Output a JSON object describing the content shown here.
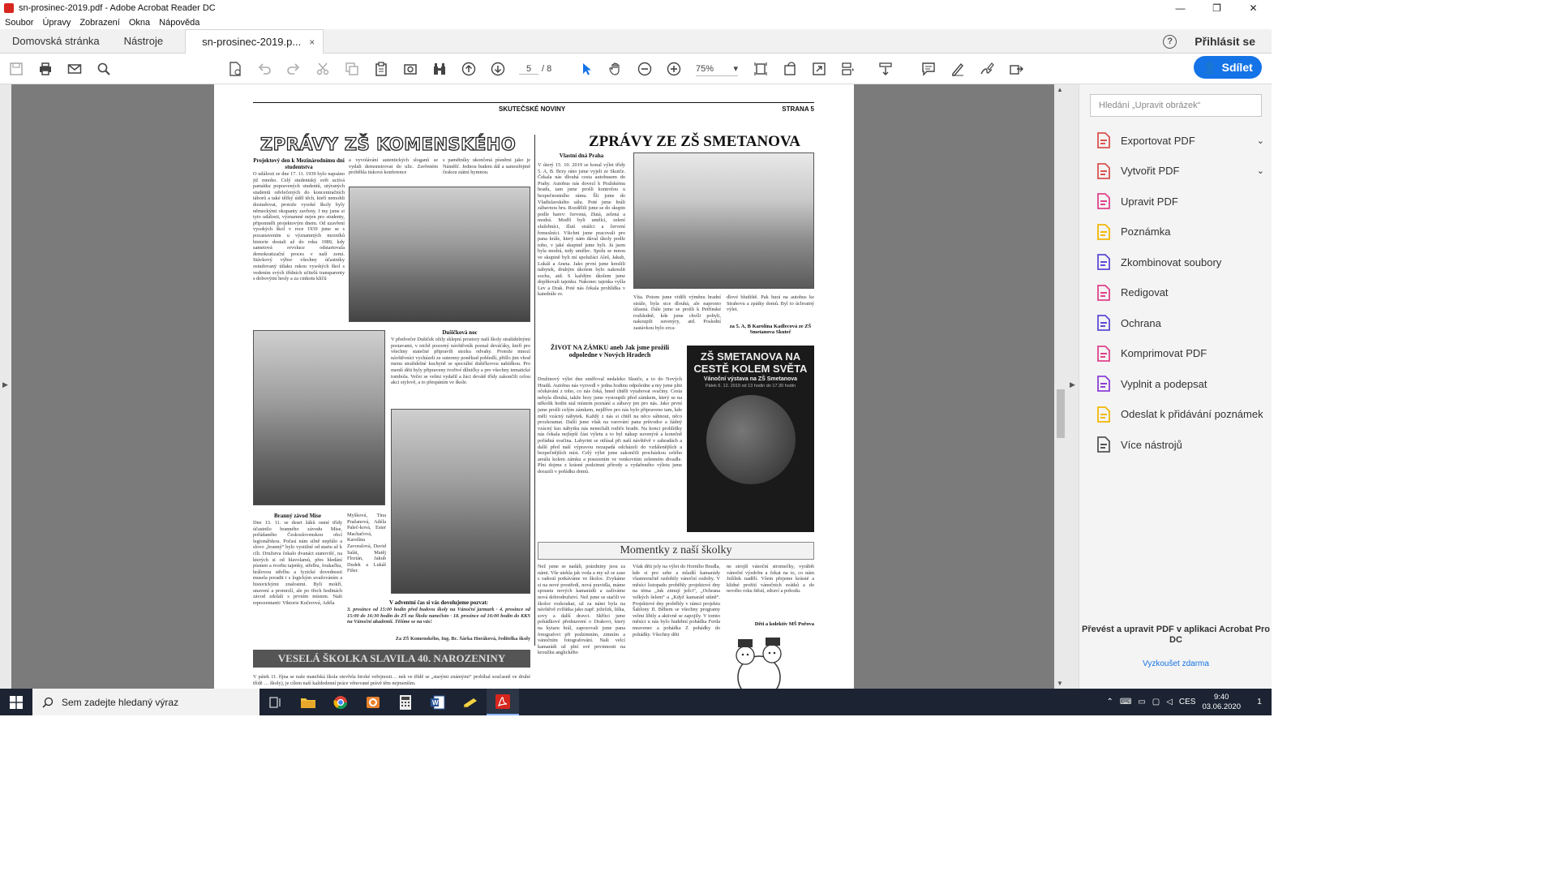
{
  "window": {
    "title": "sn-prosinec-2019.pdf - Adobe Acrobat Reader DC",
    "minimize": "—",
    "maximize": "❐",
    "close": "✕"
  },
  "menu": [
    "Soubor",
    "Úpravy",
    "Zobrazení",
    "Okna",
    "Nápověda"
  ],
  "tabs": {
    "home": "Domovská stránka",
    "tools": "Nástroje",
    "document": "sn-prosinec-2019.p...",
    "close": "×",
    "help": "?",
    "signin": "Přihlásit se"
  },
  "toolbar": {
    "page_current": "5",
    "page_total": "/ 8",
    "zoom": "75%",
    "share": "Sdílet"
  },
  "page": {
    "running_head_center": "SKUTEČSKÉ NOVINY",
    "running_head_right": "STRANA 5",
    "left_heading": "ZPRÁVY ZŠ KOMENSKÉHO",
    "right_heading": "ZPRÁVY ZE ZŠ SMETANOVA",
    "sub_projektovy": "Projektový den k Mezinárodnímu dni studentstva",
    "txt_projektovy": "O události ze dne 17. 11. 1939 bylo napsáno již mnoho. Celý studentský svět uctívá památku popravených studentů, utýraných studentů odvlečených do koncentračních táborů a také těžký úděl těch, kteří nemohli dostudovat, protože vysoké školy byly německými okupanty zavřeny. I my jsme si tyto události, významné nejen pro studenty, připomněli projektovým dnem. Od uzavření vysokých škol v roce 1939 jsme se s pozastavením u významných mezníků historie dostali až do roku 1989, kdy sametová revoluce odstartovala demokratizační proces v naší zemi. Stávkový výbor všechny účastníky ostudovaný útlaku rukou vysokých škol s vedením svých třídních učitelů transparenty s dobovými hesly a za cinkotu klíčů",
    "txt_col2_top": "a vyvolávání autentických sloganů se vydali demonstrovat do ulic. Zavřeném proběhla tisková konference",
    "txt_col3_top": "s pamětníky ukončená písněmi jako je Náměšť. Jednou budem dál a samozřejmě českou státní hymnou.",
    "sub_duchova": "Dušičková noc",
    "txt_duchova": "V předvečer Dušiček ožily sklepní prostory naší školy strašidelnými postavami, v nichž pozorný návštěvník poznal deváťáky, kteří pro všechny statečné připravili stezku odvahy. Protože mnozí návštěvníci vycházeli ze sutereny poněkud pobledlí, přišlo jim vhod menu strašidelné kuchyně se speciální dušičkovou nabídkou. Pro menší děti byly připraveny tvořivé dílničky a pro všechny tematické tombola. Večer se velmi vydařil a žáci devátě třídy zakončili celou akci stylově, a to přespáním ve škole.",
    "sub_zavod": "Branný závod Míse",
    "txt_zavod": "Dne 13. 11. se deset žáků osmé třídy účastnilo branného závodu Míse, pořádaného Československou obcí legionářskou. Počasí nám silně nepřálo a slovo „branný“ bylo vystižné od startu až k cíli. Družstva čekalo dvanáct stanovišť, na kterých si od hlavolamů, přes hledání písmen a tvorbu tajenky, střelbu, foukačku, hrálovou střelbu a fyzické dovednosti musela poradit i s logickým uvažováním a historickými znalostmi. Byli mokří, unavení a promrzlí, ale po třech hodinách závod zdolali s prvním místem. Naši reprezentanti: Viktorie Kučerová, Adéla",
    "txt_zavod2": "Myšková, Tina Pražanová, Adéla Paleč-ková, Ester Machačová, Karolína Zavoralová, David Salát, Matěj Florián, Jakub Dudek a Lukáš Fišer.",
    "sub_advent": "V adventní čas si vás dovolujeme pozvat:",
    "txt_advent": "3. prosince od 15:00 hodin před budovu školy na Vánoční jarmark · 4. prosince od 15:00 do 16:30 hodin do ZŠ na Školu nanečisto · 18. prosince od 16:00 hodin do KKS na Vánoční akademii. Těšíme se na vás!",
    "sign_komenskeho": "Za ZŠ Komenského, Ing. Bc. Šárka Horáková, ředitelka školy",
    "banner_skolka": "VESELÁ ŠKOLKA SLAVILA 40. NAROZENINY",
    "txt_skolka": "V pátek 11. října se naše mateřská škola otevřela široké veřejnosti… nek ve třídě se „starými známými“ probíhal současně ve druhé třídě … školy), je cílem naší každodenní práce věnované právě těm nejmenším.",
    "sub_praha": "Vlastní dná Praha",
    "txt_praha": "V úterý 15. 10. 2019 se konal výlet třídy 5. A, B. Brzy ráno jsme vyjeli ze Skutče. Čekala nás dlouhá cesta autobusem do Prahy. Autobus nás dovezl k Pražskému hradu, tam jsme prošli kontrolou u bezpečnostního rámu. Šli jsme do Vladislavského sálu. Poté jsme hráli zábavnou hru. Rozdělili jsme se do skupin podle barev: červená, žlutá, zelená a modrá. Modří byli umělci, zelení služebníci, žlutí strážci a červení řemeslníci. Všichni jsme pracovali pro pana krále, který nám dával úkoly podle toho, v jaké skupině jsme byli. Já jsem byla modrá, tedy umělec. Spolu se mnou ve skupině byli mí spolužáci Aleš, Jakub, Lukáš a Aneta. Jako první jsme kreslili nábytek, druhým úkolem bylo nakreslit sochu, atd. S každým úkolem jsme doplňovali tajenku. Nakonec tajenka vyšla Lev a Drak. Poté nás čekala prohlídka v katedrále sv.",
    "txt_praha2": "Víta. Potom jsme viděli výměnu hradní stráže, byla sice dlouhá, ale naprosto úžasná. Dále jsme se prošli k Petřínské rozhledně, kde jsme chvíli pobyli, nakoupili suvenýry, atd. Poslední zastávkou bylo zrca-",
    "txt_praha3": "dlové bludiště. Pak hurá na autobus ke Strahovu a zpátky domů. Byl to úchvatný výlet.",
    "sign_praha": "za 5. A, B Karolína Kadlecová ze ZŠ Smetanova Skuteč",
    "sub_zamek": "ŽIVOT NA ZÁMKU aneb Jak jsme prožili odpoledne v Nových Hradech",
    "txt_zamek": "Družinový výlet dne směřoval nedaleko Skutče, a to do Nových Hradů. Autobus nás vyzvedl v jedna hodinu odpoledne a my jsme plni očekávání z toho, co nás čeká, hned chtěli vytahovat svačiny. Cesta nebyla dlouhá, takže brzy jsme vystoupili před zámkem, který se na několik hodin stal místem poznání a zábavy jen pro nás. Jako první jsme prošli celým zámkem, nejdříve pro nás bylo připraveno tam, kde měli vzácný nábytek. Každý z nás si chtěl na něco sáhnout, něco prozkoumat. Další jsme však na varování pana průvodce a žádný vzácný kus nábytku nás nenecháli rodiče hradit. Na konci prohlídky nás čekala nejlepší část výletu a to byl nákup suvenýrů a konečně pořádná svačina. Labyrint se otřásal při naší návštěvě v zahradách a další před naší výpravou nezapadá odcházeli do vzdálenějších a bezpečnějších míst. Celý výlet jsme zakončili procházkou celého areálu kolem zámku a posezením ve venkovním zelenném divadle. Plni dojmu z krásné podzimní přírody a vydařeného výletu jsme dorazili v pořádku domů.",
    "poster_title": "ZŠ SMETANOVA NA CESTĚ KOLEM SVĚTA",
    "poster_sub": "Vánoční výstava na ZŠ Smetanova",
    "poster_date": "Pátek 6. 12. 2019 od 13 hodin do 17.30 hodin",
    "moment_heading": "Momentky z naší školky",
    "txt_moment1": "Než jsme se nadáli, prázdniny jsou za námi. Vše utekla jak voda a my už se zase s radostí potkáváme ve školce. Zvykáme si na nové prostředí, nová pravidla, máme spoustu nových kamarádů a zažíváme nová dobrodružství. Než jsme se stačili ve školce rozkoukat, už za námi byla na návštěvě zvířátka jako např. ježeček, liška, sovy a další dravci. Skřítci jsme pohádkové představení o Drakovi, který na kytaru hrál, zapozovali jsme pana fotografovi při podzimním, zimním a vánočním fotografování. Naši velcí kamarádi už plní své povinnosti na kroužku anglického",
    "txt_moment2": "Však děti jely na výlet do Horního Bradla, kde si pro sebe a mladší kamarády vlastnoručně ozdobily vánoční ozdoby. V měsíci listopadu proběhly projektové dny na téma „Jak zimují ježci“, „Ochrana velkých šelem“ a „Když kamarád stůně“. Projektové dny proběhly v rámci projektu Šablony II. Během se všechny programy velmi líbily a aktivně se zapojily. V tomto měsíci u nás bylo hudební pohádka Ferda mravenec a pohádka Z pohádky do pohádky. Všechny děti",
    "txt_moment3": "ne strojíš vánoční stromečky, vyrábět vánoční výzdobu a čekat na to, co nám Ježíšek nadělí. Všem přejeme krásné a klidné prožití vánočních svátků a do nového roku štěstí, zdraví a pohodu.",
    "sign_moment": "Děti a kolektiv MŠ Pořova"
  },
  "panel": {
    "search_placeholder": "Hledání „Upravit obrázek“",
    "tools": [
      {
        "label": "Exportovat PDF",
        "color": "#d9534f",
        "chev": "⌄"
      },
      {
        "label": "Vytvořit PDF",
        "color": "#d9534f",
        "chev": "⌄"
      },
      {
        "label": "Upravit PDF",
        "color": "#e0428c",
        "chev": ""
      },
      {
        "label": "Poznámka",
        "color": "#f2b705",
        "chev": ""
      },
      {
        "label": "Zkombinovat soubory",
        "color": "#5b4bd6",
        "chev": ""
      },
      {
        "label": "Redigovat",
        "color": "#e0428c",
        "chev": ""
      },
      {
        "label": "Ochrana",
        "color": "#5b4bd6",
        "chev": ""
      },
      {
        "label": "Komprimovat PDF",
        "color": "#e0428c",
        "chev": ""
      },
      {
        "label": "Vyplnit a podepsat",
        "color": "#8a3fd6",
        "chev": ""
      },
      {
        "label": "Odeslat k přidávání poznámek",
        "color": "#f2b705",
        "chev": ""
      },
      {
        "label": "Více nástrojů",
        "color": "#555555",
        "chev": ""
      }
    ],
    "promo": "Převést a upravit PDF v aplikaci Acrobat Pro DC",
    "trial": "Vyzkoušet zdarma"
  },
  "taskbar": {
    "search": "Sem zadejte hledaný výraz",
    "lang": "CES",
    "time": "9:40",
    "date": "03.06.2020",
    "notif": "1"
  }
}
